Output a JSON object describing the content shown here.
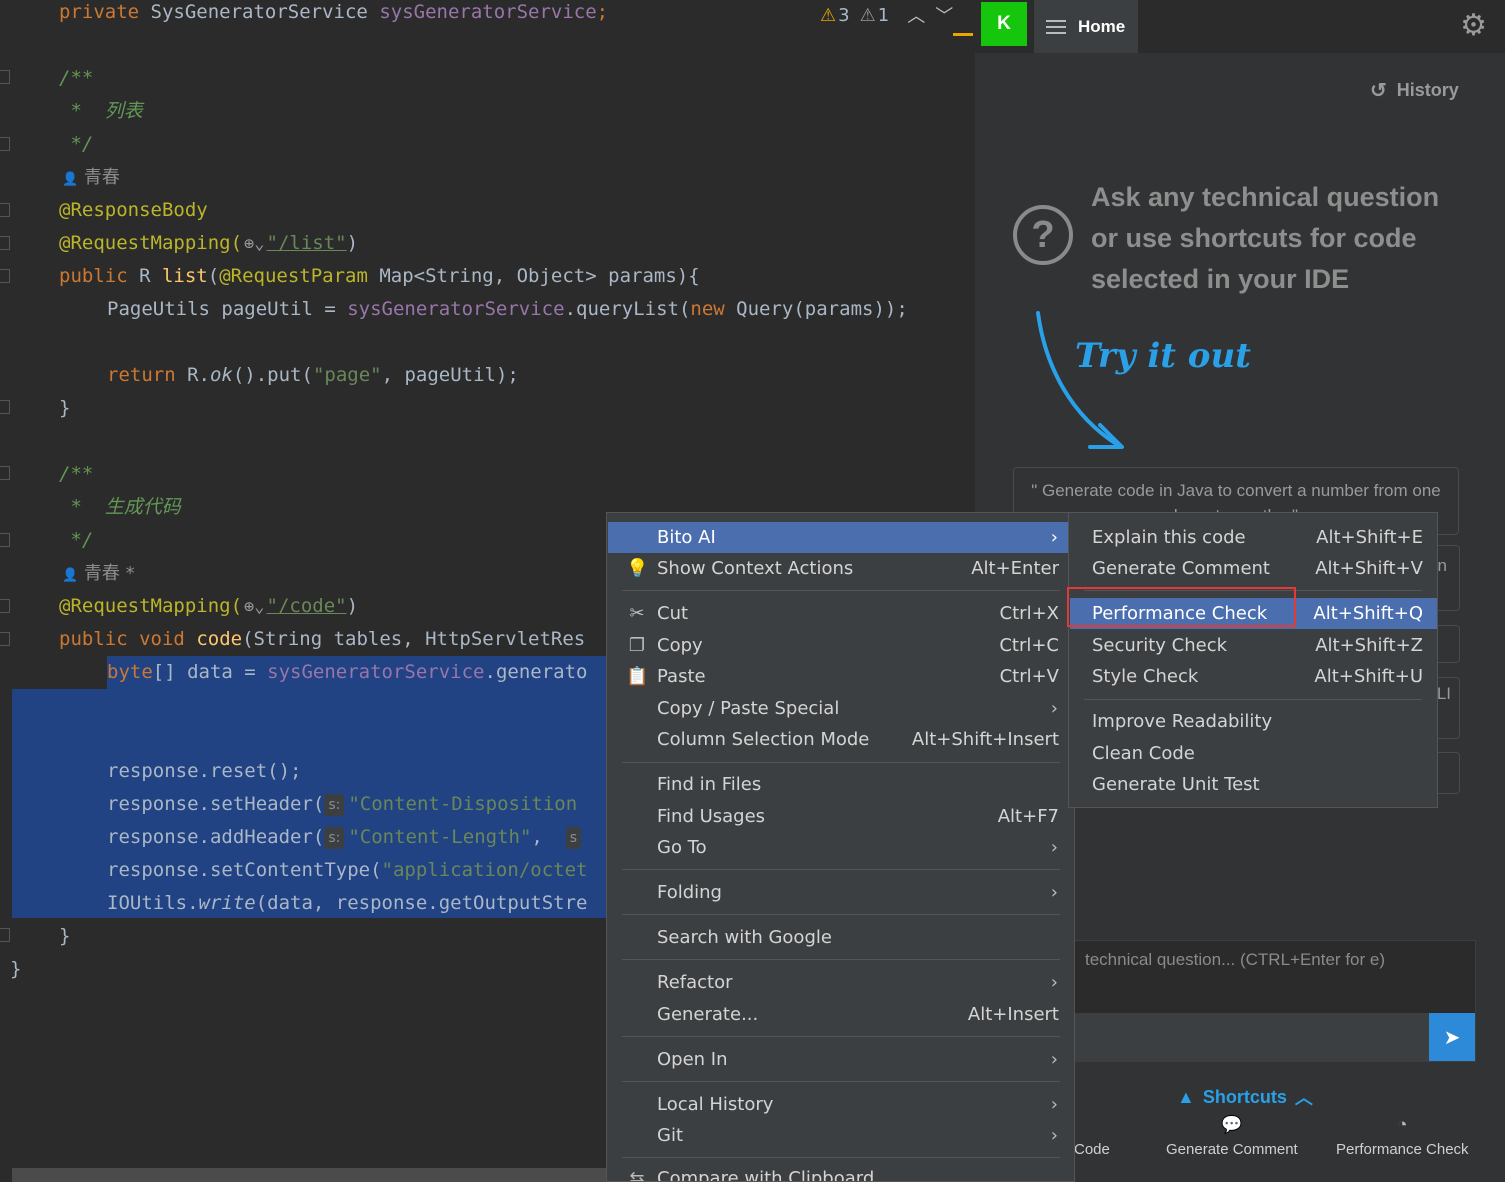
{
  "editor": {
    "inspections": {
      "warnings": "3",
      "weak_warnings": "1"
    },
    "lines": {
      "l1": [
        "private",
        "SysGeneratorService",
        "sysGeneratorService",
        ";"
      ],
      "c1_open": "/**",
      "c1_text": " *  列表",
      "c1_close": " */",
      "author1": "青春",
      "ann_responsebody": "@ResponseBody",
      "ann_req1": "@RequestMapping(",
      "path1": "\"/list\"",
      "sig1": {
        "pub": "public",
        "r": " R ",
        "name": "list",
        "open": "(",
        "ann": "@RequestParam",
        "rest": " Map<String, Object> params){"
      },
      "body1": {
        "t": "PageUtils pageUtil = ",
        "svc": "sysGeneratorService",
        "call": ".queryList(",
        "new": "new",
        "rest": " Query(params));"
      },
      "ret1": {
        "kw": "return",
        "a": " R.",
        "ok": "ok",
        "b": "().put(",
        "s": "\"page\"",
        "c": ", pageUtil);"
      },
      "close1": "}",
      "c2_open": "/**",
      "c2_text": " *  生成代码",
      "c2_close": " */",
      "author2": "青春",
      "author2_mod": "*",
      "ann_req2": "@RequestMapping(",
      "path2": "\"/code\"",
      "sig2": {
        "pub": "public",
        "void": "void",
        "name": "code",
        "rest": "(String tables, HttpServletRes"
      },
      "byte": {
        "kw": "byte",
        "t": "[] data = ",
        "svc": "sysGeneratorService",
        "call": ".generato"
      },
      "reset": "response.reset();",
      "setheader": {
        "a": "response.setHeader(",
        "hint": "s:",
        "s": "\"Content-Disposition"
      },
      "addheader": {
        "a": "response.addHeader(",
        "hint": "s:",
        "s": "\"Content-Length\"",
        "c": ",",
        "hint2": "s"
      },
      "ctype": {
        "a": "response.setContentType(",
        "s": "\"application/octet"
      },
      "ioutils": {
        "a": "IOUtils.",
        "w": "write",
        "b": "(data, response.getOutputStre"
      },
      "close2": "}",
      "close3": "}"
    }
  },
  "bito": {
    "avatar": "K",
    "home_label": "Home",
    "history_label": "History",
    "ask_text": "Ask any technical question or use shortcuts for code selected in your IDE",
    "try_it_out": "Try it out",
    "example_text": "\" Generate code in Java to convert a number from one base to another\"",
    "card_fragment_1": "n",
    "card_fragment_2": "LI",
    "input_placeholder": "technical question... (CTRL+Enter for e)",
    "shortcuts_label": "Shortcuts",
    "shortcut_buttons": [
      "Code",
      "Generate Comment",
      "Performance Check"
    ]
  },
  "context_menu": {
    "items": {
      "bito_ai": "Bito AI",
      "show_context": {
        "label": "Show Context Actions",
        "shortcut": "Alt+Enter"
      },
      "cut": {
        "label": "Cut",
        "shortcut": "Ctrl+X"
      },
      "copy": {
        "label": "Copy",
        "shortcut": "Ctrl+C"
      },
      "paste": {
        "label": "Paste",
        "shortcut": "Ctrl+V"
      },
      "copy_paste_special": "Copy / Paste Special",
      "column_selection": {
        "label": "Column Selection Mode",
        "shortcut": "Alt+Shift+Insert"
      },
      "find_in_files": "Find in Files",
      "find_usages": {
        "label": "Find Usages",
        "shortcut": "Alt+F7"
      },
      "go_to": "Go To",
      "folding": "Folding",
      "search_google": "Search with Google",
      "refactor": "Refactor",
      "generate": {
        "label": "Generate...",
        "shortcut": "Alt+Insert"
      },
      "open_in": "Open In",
      "local_history": "Local History",
      "git": "Git",
      "compare_clipboard": "Compare with Clipboard"
    }
  },
  "bito_submenu": {
    "explain": {
      "label": "Explain this code",
      "shortcut": "Alt+Shift+E"
    },
    "gen_comment": {
      "label": "Generate Comment",
      "shortcut": "Alt+Shift+V"
    },
    "performance": {
      "label": "Performance Check",
      "shortcut": "Alt+Shift+Q"
    },
    "security": {
      "label": "Security Check",
      "shortcut": "Alt+Shift+Z"
    },
    "style": {
      "label": "Style Check",
      "shortcut": "Alt+Shift+U"
    },
    "readability": "Improve Readability",
    "clean": "Clean Code",
    "unit_test": "Generate Unit Test"
  },
  "colors": {
    "selection": "#214283",
    "menu_active": "#4b6eaf",
    "highlight_box": "#e53935",
    "accent": "#2aa0e8"
  }
}
